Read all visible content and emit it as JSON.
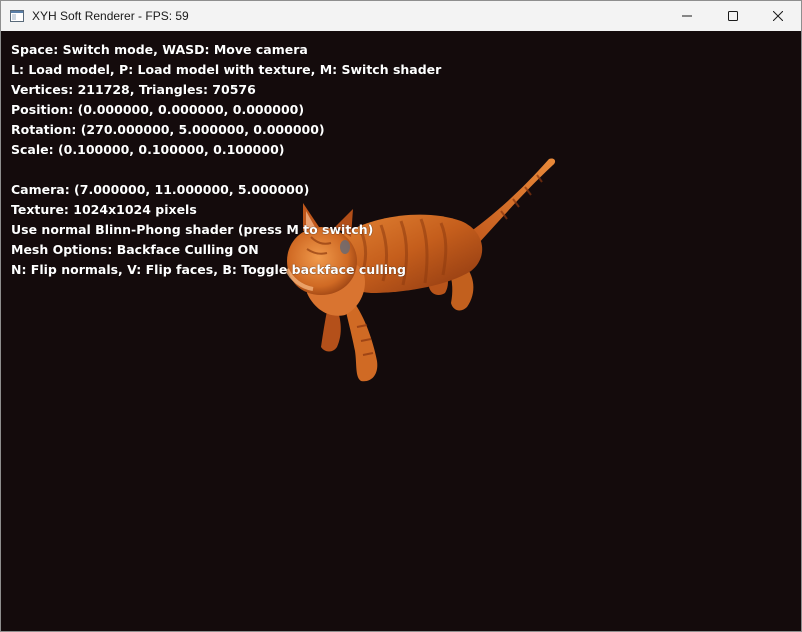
{
  "window": {
    "title": "XYH Soft Renderer - FPS: 59",
    "icon": "app-window-icon",
    "controls": [
      "minimize-icon",
      "maximize-icon",
      "close-icon"
    ]
  },
  "hud": {
    "line1": "Space: Switch mode, WASD: Move camera",
    "line2": "L: Load model, P: Load model with texture, M: Switch shader",
    "line3": "Vertices: 211728, Triangles: 70576",
    "line4": "Position: (0.000000, 0.000000, 0.000000)",
    "line5": "Rotation: (270.000000, 5.000000, 0.000000)",
    "line6": "Scale: (0.100000, 0.100000, 0.100000)",
    "line7": "Camera: (7.000000, 11.000000, 5.000000)",
    "line8": "Texture: 1024x1024 pixels",
    "line9": "Use normal Blinn-Phong shader (press M to switch)",
    "line10": "Mesh Options: Backface Culling ON",
    "line11": "N: Flip normals, V: Flip faces, B: Toggle backface culling"
  },
  "scene": {
    "background_color": "#140b0c",
    "model": "orange tabby cat (textured 3D model)",
    "model_colors": [
      "#c05a18",
      "#e07a2a",
      "#8e3a0e",
      "#f0a050"
    ]
  }
}
